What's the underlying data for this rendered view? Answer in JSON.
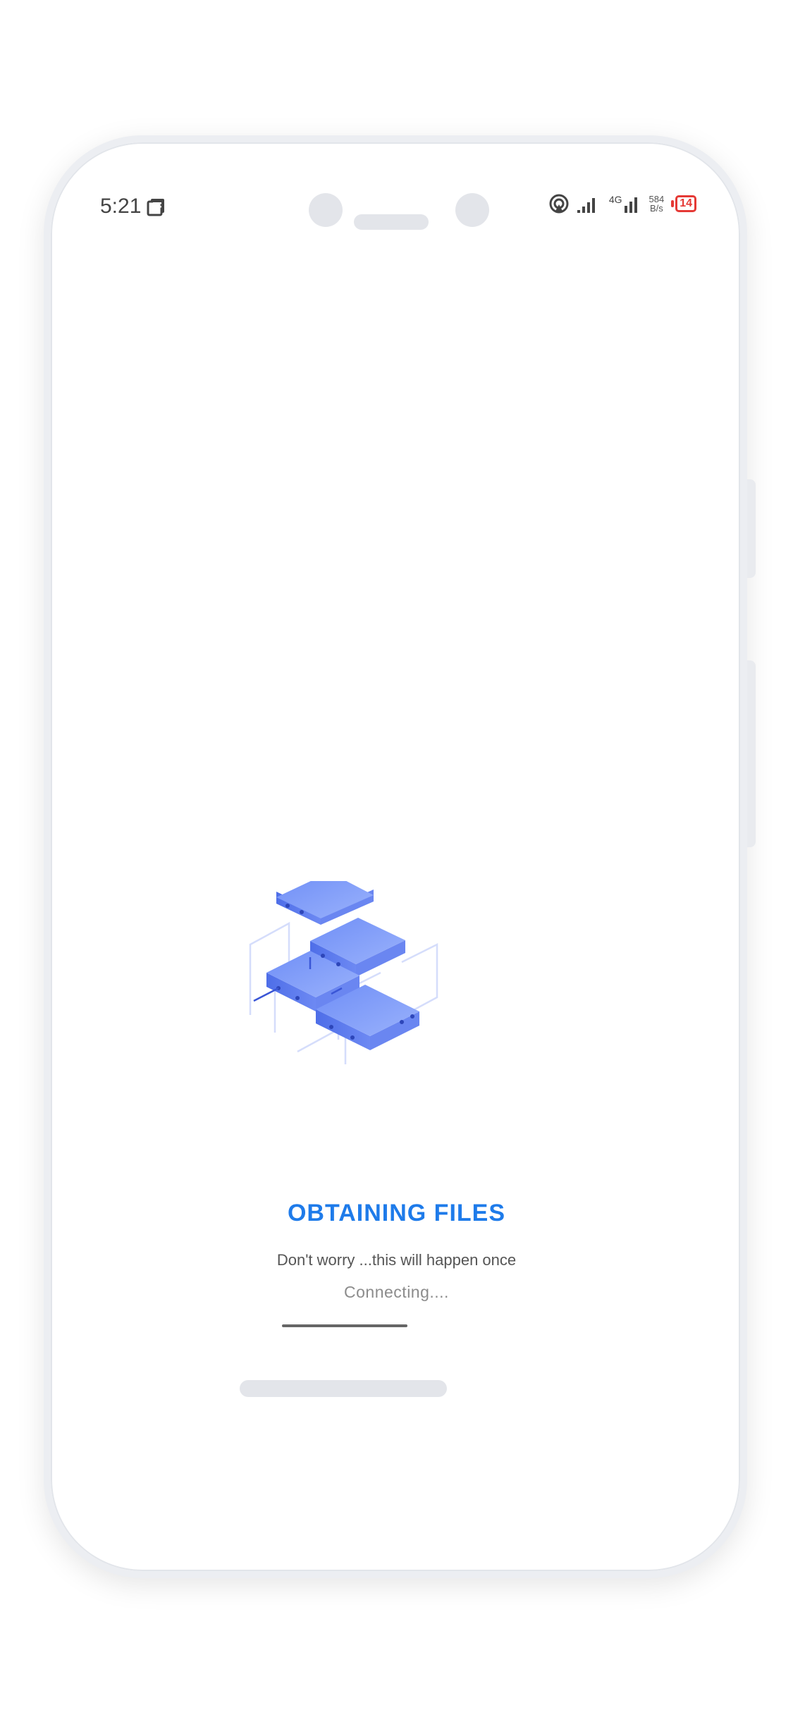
{
  "status_bar": {
    "time": "5:21",
    "network_type": "4G",
    "net_speed_value": "584",
    "net_speed_unit": "B/s",
    "battery": "14"
  },
  "loading": {
    "title": "OBTAINING FILES",
    "subtitle": "Don't worry ...this will happen once",
    "status": "Connecting....",
    "progress": 1.0
  },
  "colors": {
    "accent": "#1e7bea",
    "battery_low": "#e53935",
    "illustration_blue": "#5b7ff0"
  },
  "icons": [
    "notes-icon",
    "hotspot-icon",
    "signal-icon",
    "battery-icon",
    "servers-illustration"
  ]
}
